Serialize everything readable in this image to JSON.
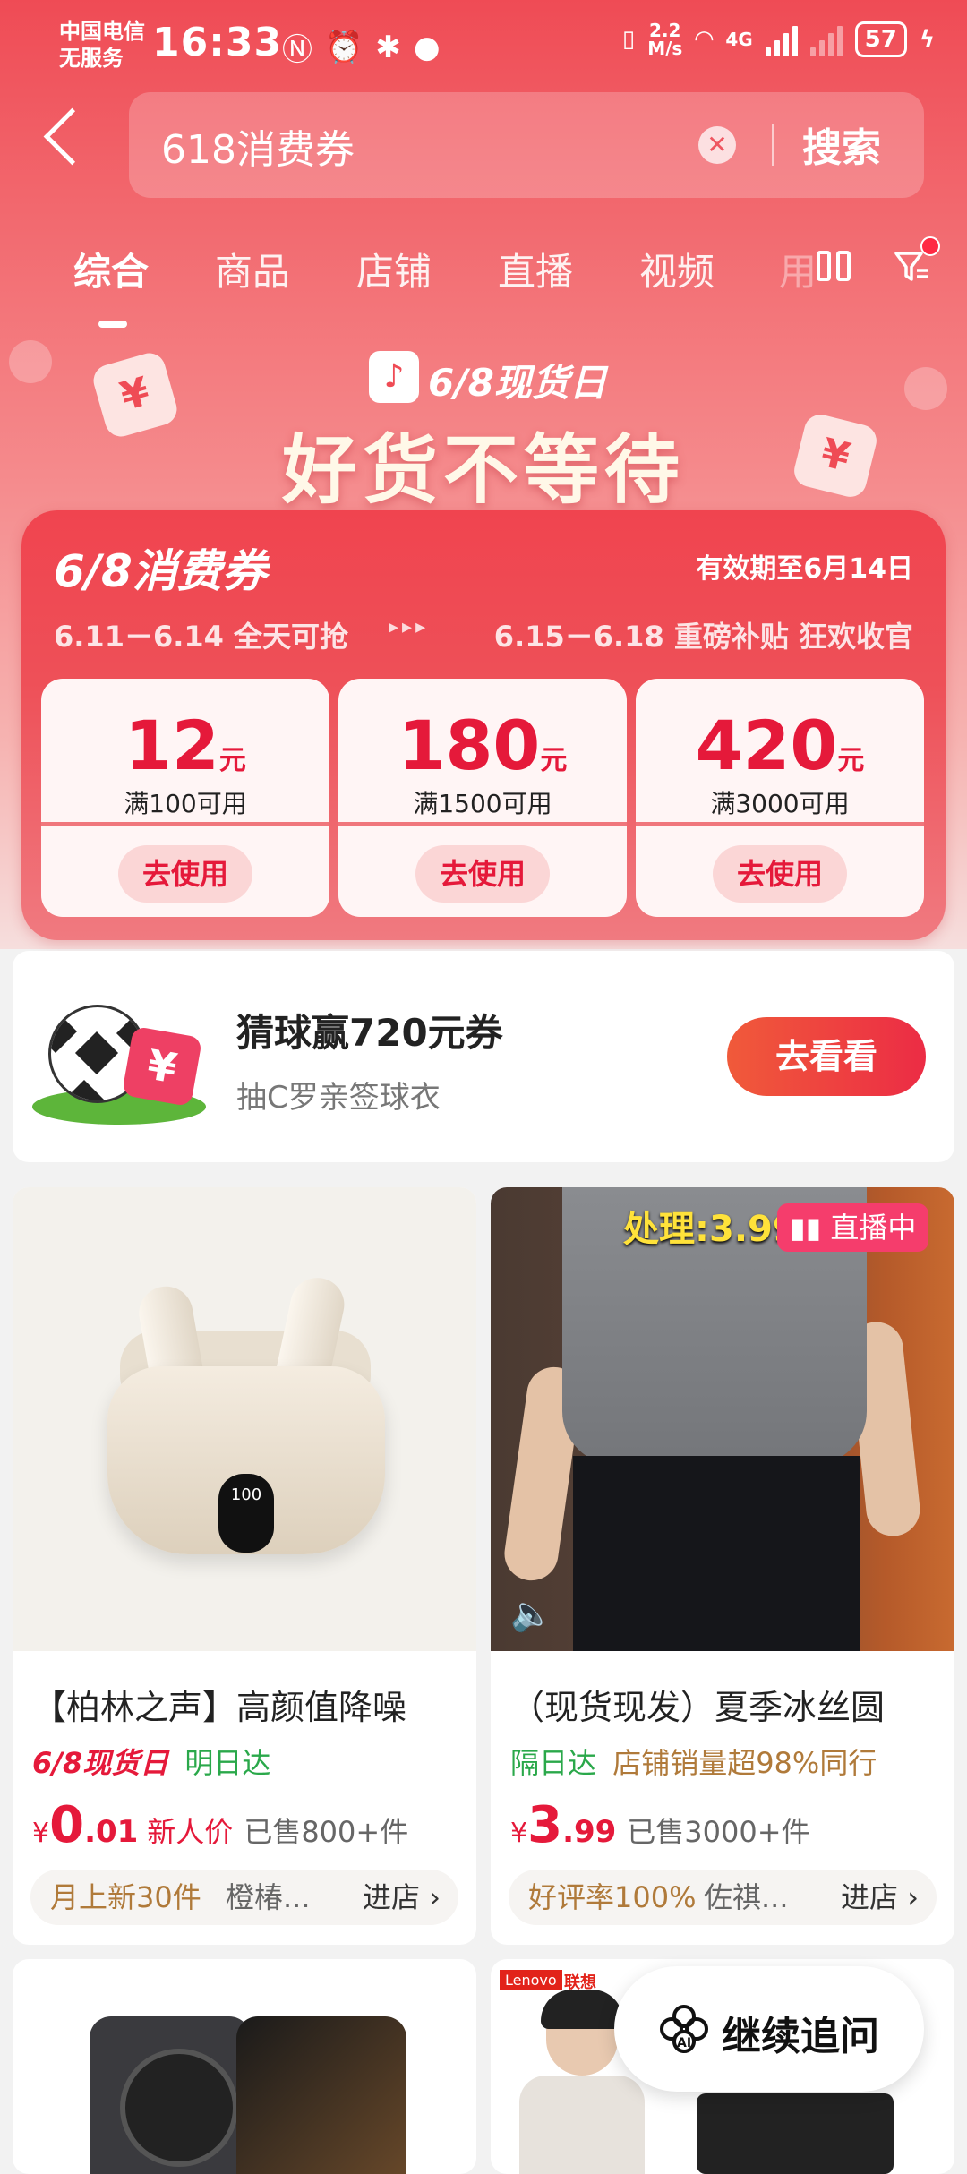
{
  "status_bar": {
    "carrier_line1": "中国电信",
    "carrier_line2": "无服务",
    "time": "16:33",
    "speed_top": "2.2",
    "speed_bottom": "M/s",
    "network": "4G",
    "battery": "57"
  },
  "search": {
    "query": "618消费券",
    "clear_glyph": "✕",
    "button": "搜索"
  },
  "tabs": [
    {
      "label": "综合",
      "active": true
    },
    {
      "label": "商品",
      "active": false
    },
    {
      "label": "店铺",
      "active": false
    },
    {
      "label": "直播",
      "active": false
    },
    {
      "label": "视频",
      "active": false
    }
  ],
  "tab_overflow": "用",
  "banner": {
    "logo_glyph": "♪",
    "subtitle": "6/8现货日",
    "title": "好货不等待",
    "yen": "¥"
  },
  "coupon_panel": {
    "title": "6/8消费券",
    "validity": "有效期至6月14日",
    "period1": "6.11－6.14 全天可抢",
    "arrows": "▸▸▸",
    "period2": "6.15－6.18 重磅补贴 狂欢收官",
    "coupons": [
      {
        "amount": "12",
        "unit": "元",
        "condition": "满100可用",
        "button": "去使用"
      },
      {
        "amount": "180",
        "unit": "元",
        "condition": "满1500可用",
        "button": "去使用"
      },
      {
        "amount": "420",
        "unit": "元",
        "condition": "满3000可用",
        "button": "去使用"
      }
    ]
  },
  "promo": {
    "yen": "¥",
    "title": "猜球赢720元券",
    "subtitle": "抽C罗亲签球衣",
    "button": "去看看"
  },
  "products": [
    {
      "name": "【柏林之声】高颜值降噪",
      "tag1": "6/8现货日",
      "tag2": "明日达",
      "currency": "¥",
      "price_int": "0",
      "price_dec": ".01",
      "price_note": "新人价",
      "sold": "已售800+件",
      "shop_highlight": "月上新30件",
      "shop_name": "橙椿...",
      "enter": "进店 ›",
      "case_display": "100"
    },
    {
      "name": "（现货现发）夏季冰丝圆",
      "tag1": "隔日达",
      "tag2": "店铺销量超98%同行",
      "currency": "¥",
      "price_int": "3",
      "price_dec": ".99",
      "sold": "已售3000+件",
      "shop_highlight": "好评率100%",
      "shop_name": "佐祺...",
      "enter": "进店 ›",
      "overlay_price": "处理:3.99",
      "live_badge": "直播中",
      "speaker": "🔈"
    }
  ],
  "lenovo": {
    "brand": "Lenovo",
    "brand_cn": "联想"
  },
  "follow_up": {
    "label": "继续追问"
  },
  "colors": {
    "accent": "#e5193a",
    "header_red": "#ef4b55",
    "live_pink": "#f53d6c",
    "green": "#2aa84a"
  }
}
